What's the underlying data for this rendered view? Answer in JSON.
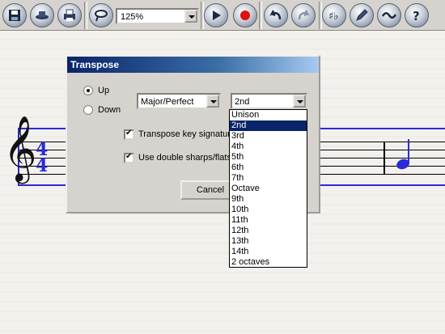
{
  "toolbar": {
    "zoom": "125%",
    "buttons": [
      "save-icon",
      "hat-icon",
      "print-icon",
      "lasso-icon",
      "play-icon",
      "record-icon",
      "undo-icon",
      "redo-icon",
      "flat-sharp-icon",
      "pencil-icon",
      "wave-icon",
      "help-icon"
    ]
  },
  "score": {
    "time_sig_top": "4",
    "time_sig_bottom": "4",
    "clef": "𝄞"
  },
  "dialog": {
    "title": "Transpose",
    "direction": {
      "up": "Up",
      "down": "Down",
      "selected": "Up"
    },
    "quality": "Major/Perfect",
    "interval": "2nd",
    "transpose_key_sig": "Transpose key signature",
    "double_sharps": "Use double sharps/flats",
    "cancel": "Cancel"
  },
  "interval_options": [
    "Unison",
    "2nd",
    "3rd",
    "4th",
    "5th",
    "6th",
    "7th",
    "Octave",
    "9th",
    "10th",
    "11th",
    "12th",
    "13th",
    "14th",
    "2 octaves"
  ],
  "interval_selected_index": 1
}
